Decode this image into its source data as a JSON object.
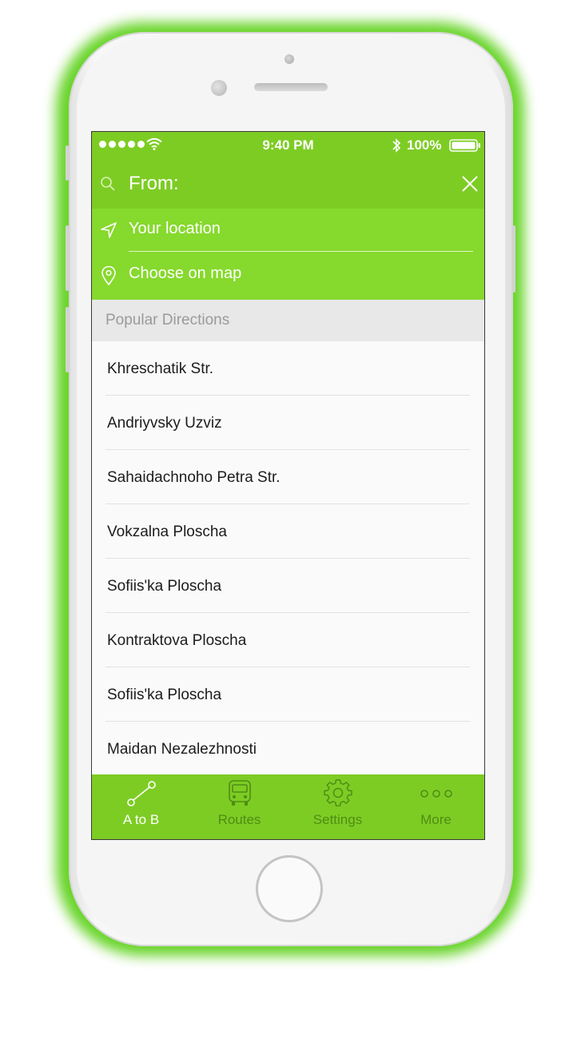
{
  "status_bar": {
    "time": "9:40 PM",
    "battery": "100%"
  },
  "search": {
    "label": "From:"
  },
  "suggestions": [
    {
      "label": "Your location",
      "icon": "navigation-arrow-icon"
    },
    {
      "label": "Choose on map",
      "icon": "map-pin-icon"
    }
  ],
  "section": {
    "title": "Popular Directions"
  },
  "directions": [
    "Khreschatik Str.",
    "Andriyvsky Uzviz",
    "Sahaidachnoho Petra Str.",
    "Vokzalna Ploscha",
    "Sofiis'ka Ploscha",
    "Kontraktova Ploscha",
    "Sofiis'ka Ploscha",
    "Maidan Nezalezhnosti"
  ],
  "tabs": [
    {
      "label": "A to B",
      "icon": "route-icon",
      "active": true
    },
    {
      "label": "Routes",
      "icon": "bus-icon",
      "active": false
    },
    {
      "label": "Settings",
      "icon": "gear-icon",
      "active": false
    },
    {
      "label": "More",
      "icon": "more-icon",
      "active": false
    }
  ],
  "colors": {
    "accent": "#7dcc24",
    "accent_light": "#86d92d",
    "glow": "#5fd21c",
    "tab_inactive": "#4f8d14"
  }
}
